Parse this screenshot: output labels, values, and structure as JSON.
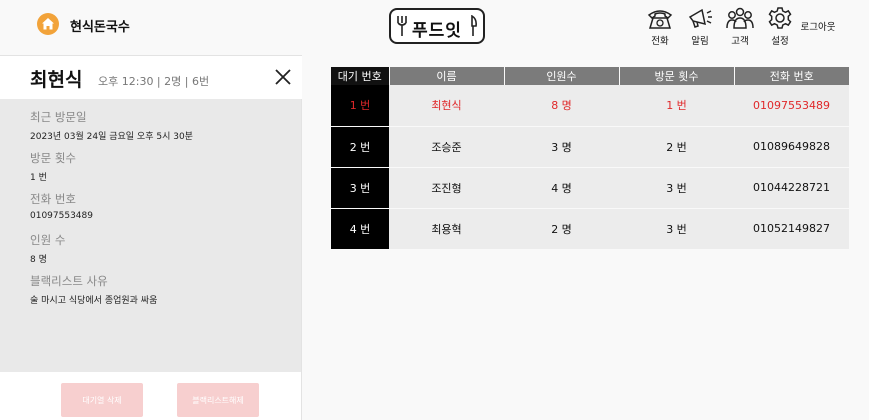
{
  "header": {
    "store_name": "현식돈국수",
    "logo_text": "푸드잇",
    "nav": [
      {
        "label": "전화",
        "icon": "telephone-icon"
      },
      {
        "label": "알림",
        "icon": "megaphone-icon"
      },
      {
        "label": "고객",
        "icon": "customers-icon"
      },
      {
        "label": "설정",
        "icon": "gear-icon"
      }
    ],
    "logout_label": "로그아웃"
  },
  "detail": {
    "name": "최현식",
    "meta": "오후 12:30 | 2명 | 6번",
    "fields": [
      {
        "label": "최근 방문일",
        "value": "2023년 03월 24일 금요일 오후 5시 30분"
      },
      {
        "label": "방문 횟수",
        "value": "1 번"
      },
      {
        "label": "전화 번호",
        "value": "01097553489"
      },
      {
        "label": "인원 수",
        "value": "8 명"
      },
      {
        "label": "블랙리스트 사유",
        "value": "술 마시고 식당에서 종업원과 싸움"
      }
    ],
    "buttons": {
      "remove_waiting": "대기열 삭제",
      "unblacklist": "블랙리스트해제"
    }
  },
  "table": {
    "headers": [
      "대기 번호",
      "이름",
      "인원수",
      "방문 횟수",
      "전화 번호"
    ],
    "rows": [
      {
        "num": "1 번",
        "name": "최현식",
        "people": "8 명",
        "visits": "1 번",
        "phone": "01097553489"
      },
      {
        "num": "2 번",
        "name": "조승준",
        "people": "3 명",
        "visits": "2 번",
        "phone": "01089649828"
      },
      {
        "num": "3 번",
        "name": "조진형",
        "people": "4 명",
        "visits": "3 번",
        "phone": "01044228721"
      },
      {
        "num": "4 번",
        "name": "최용혁",
        "people": "2 명",
        "visits": "3 번",
        "phone": "01052149827"
      }
    ]
  },
  "colors": {
    "accent": "#f2a33a",
    "highlight": "#e0282a",
    "button": "#f7cfcf"
  }
}
